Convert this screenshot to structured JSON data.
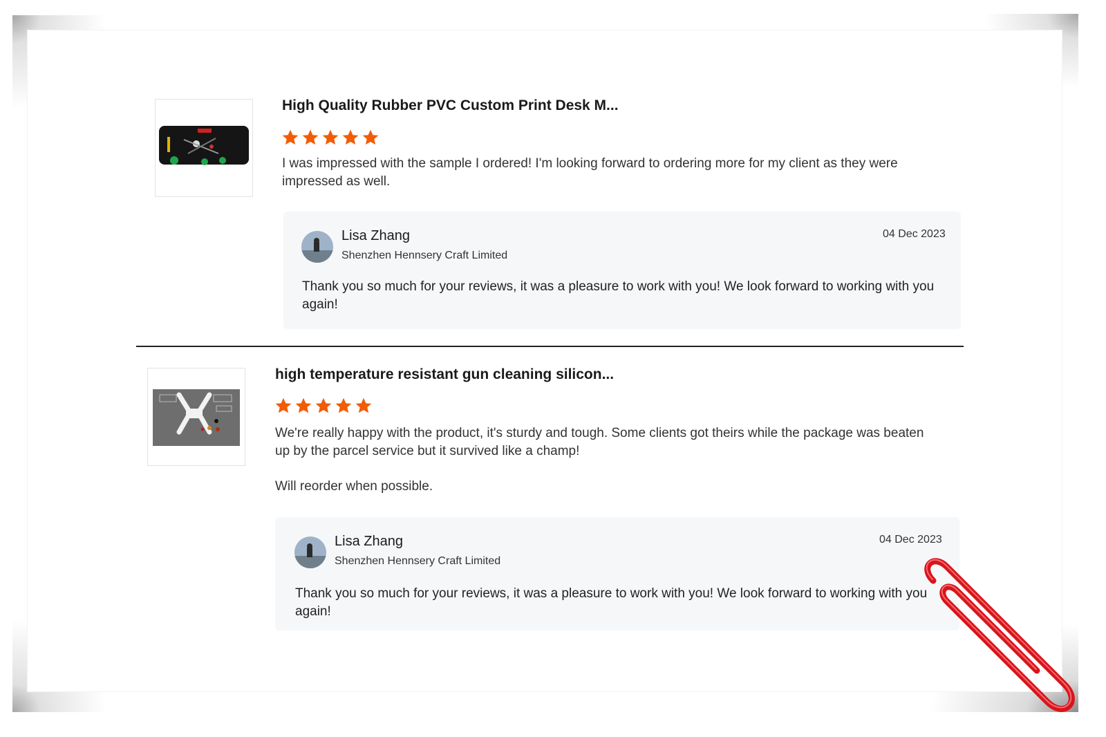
{
  "reviews": [
    {
      "product_title": "High Quality Rubber PVC Custom Print Desk M...",
      "rating": 5,
      "comment_lines": [
        "I was impressed with the sample I ordered! I'm looking forward to ordering more for my client as they were impressed as well."
      ],
      "reply": {
        "name": "Lisa Zhang",
        "company": "Shenzhen Hennsery Craft Limited",
        "date": "04 Dec 2023",
        "text": "Thank you so much for your reviews, it was a pleasure to work with you! We look forward to working with you again!"
      }
    },
    {
      "product_title": "high temperature resistant gun cleaning silicon...",
      "rating": 5,
      "comment_lines": [
        "We're really happy with the product, it's sturdy and tough. Some clients got theirs while the package was beaten up by the parcel service but it survived like a champ!",
        "Will reorder when possible."
      ],
      "reply": {
        "name": "Lisa Zhang",
        "company": "Shenzhen Hennsery Craft Limited",
        "date": "04 Dec 2023",
        "text": "Thank you so much for your reviews, it was a pleasure to work with you! We look forward to working with you again!"
      }
    }
  ],
  "colors": {
    "star": "#f25c05",
    "reply_background": "#f6f7f9",
    "paperclip": "#d9141b"
  },
  "icons": [
    "star-icon",
    "paperclip-icon"
  ]
}
